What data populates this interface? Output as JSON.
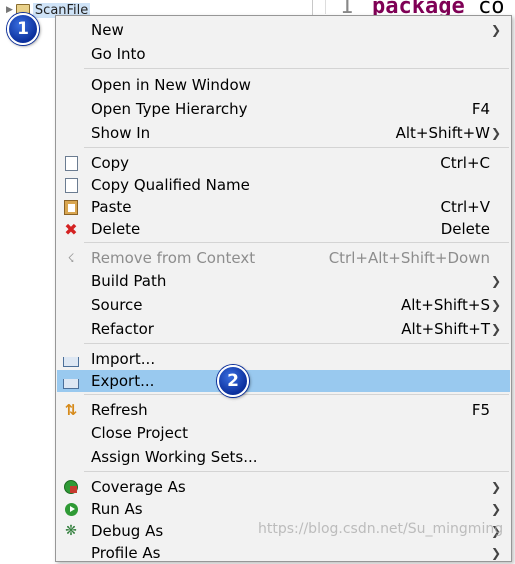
{
  "explorer": {
    "selected_item": "ScanFile"
  },
  "editor": {
    "line_number": "1",
    "keyword": "package",
    "rest": "co"
  },
  "badges": {
    "one": "1",
    "two": "2"
  },
  "menu": {
    "new": {
      "label": "New",
      "shortcut": ""
    },
    "go_into": {
      "label": "Go Into",
      "shortcut": ""
    },
    "open_window": {
      "label": "Open in New Window",
      "shortcut": ""
    },
    "open_type": {
      "label": "Open Type Hierarchy",
      "shortcut": "F4"
    },
    "show_in": {
      "label": "Show In",
      "shortcut": "Alt+Shift+W"
    },
    "copy": {
      "label": "Copy",
      "shortcut": "Ctrl+C"
    },
    "copy_qualified": {
      "label": "Copy Qualified Name",
      "shortcut": ""
    },
    "paste": {
      "label": "Paste",
      "shortcut": "Ctrl+V"
    },
    "delete": {
      "label": "Delete",
      "shortcut": "Delete"
    },
    "remove_context": {
      "label": "Remove from Context",
      "shortcut": "Ctrl+Alt+Shift+Down"
    },
    "build_path": {
      "label": "Build Path",
      "shortcut": ""
    },
    "source": {
      "label": "Source",
      "shortcut": "Alt+Shift+S"
    },
    "refactor": {
      "label": "Refactor",
      "shortcut": "Alt+Shift+T"
    },
    "import": {
      "label": "Import...",
      "shortcut": ""
    },
    "export": {
      "label": "Export...",
      "shortcut": ""
    },
    "refresh": {
      "label": "Refresh",
      "shortcut": "F5"
    },
    "close_project": {
      "label": "Close Project",
      "shortcut": ""
    },
    "assign_sets": {
      "label": "Assign Working Sets...",
      "shortcut": ""
    },
    "coverage": {
      "label": "Coverage As",
      "shortcut": ""
    },
    "run_as": {
      "label": "Run As",
      "shortcut": ""
    },
    "debug_as": {
      "label": "Debug As",
      "shortcut": ""
    },
    "profile_as": {
      "label": "Profile As",
      "shortcut": ""
    }
  },
  "watermark": "https://blog.csdn.net/Su_mingming",
  "colors": {
    "menu_bg": "#f2f2f2",
    "highlight": "#99c9ef",
    "badge": "#0b2f9c",
    "keyword": "#7f0055"
  }
}
